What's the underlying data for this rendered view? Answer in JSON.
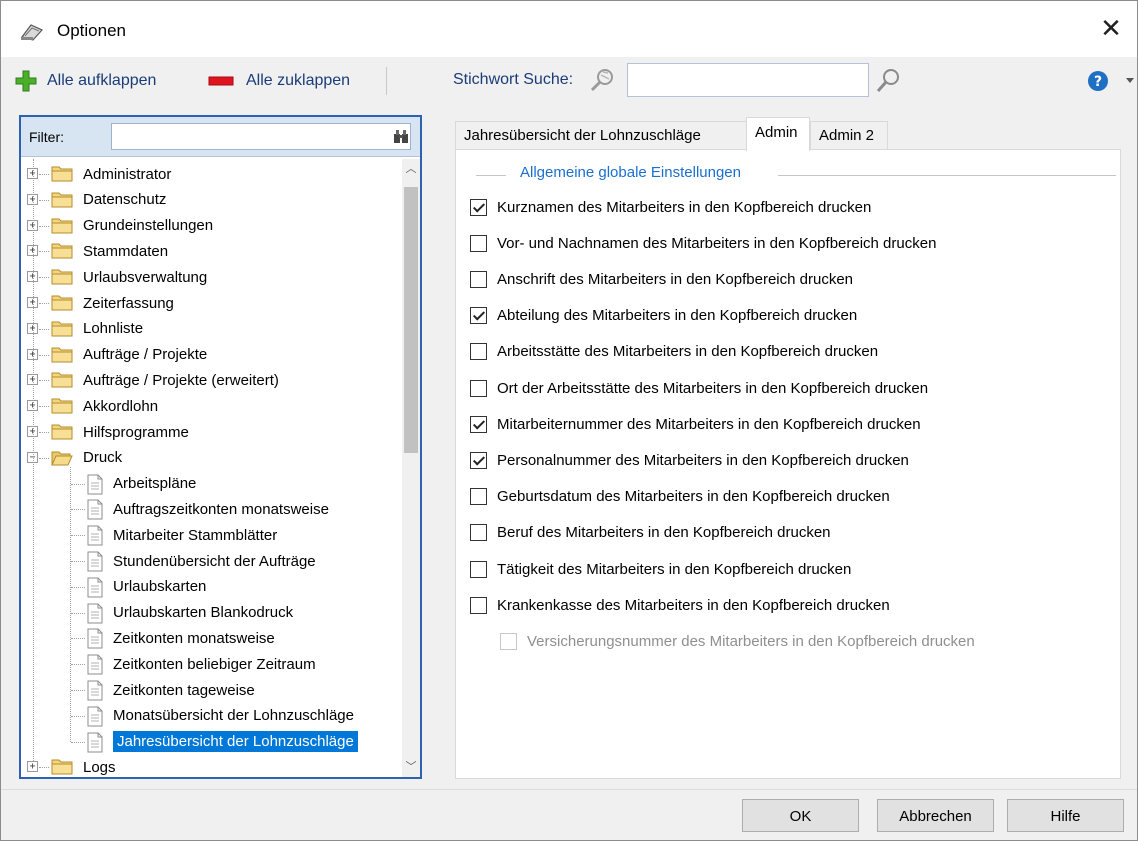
{
  "window": {
    "title": "Optionen",
    "close_glyph": "✕"
  },
  "toolbar": {
    "expand_all": "Alle aufklappen",
    "collapse_all": "Alle zuklappen",
    "search_label": "Stichwort Suche:",
    "search_value": "",
    "help_icon": "help-icon"
  },
  "filter": {
    "label": "Filter:",
    "value": ""
  },
  "tree": {
    "top_level": [
      "Administrator",
      "Datenschutz",
      "Grundeinstellungen",
      "Stammdaten",
      "Urlaubsverwaltung",
      "Zeiterfassung",
      "Lohnliste",
      "Aufträge / Projekte",
      "Aufträge / Projekte (erweitert)",
      "Akkordlohn",
      "Hilfsprogramme"
    ],
    "expanded": "Druck",
    "children": [
      "Arbeitspläne",
      "Auftragszeitkonten monatsweise",
      "Mitarbeiter Stammblätter",
      "Stundenübersicht der Aufträge",
      "Urlaubskarten",
      "Urlaubskarten Blankodruck",
      "Zeitkonten monatsweise",
      "Zeitkonten beliebiger Zeitraum",
      "Zeitkonten tageweise",
      "Monatsübersicht der Lohnzuschläge",
      "Jahresübersicht der Lohnzuschläge"
    ],
    "selected": "Jahresübersicht der Lohnzuschläge",
    "after": "Logs"
  },
  "tabs": [
    {
      "label": "Jahresübersicht der Lohnzuschläge",
      "active": false
    },
    {
      "label": "Admin",
      "active": true
    },
    {
      "label": "Admin 2",
      "active": false
    }
  ],
  "group": {
    "title": "Allgemeine globale Einstellungen"
  },
  "options": [
    {
      "label": "Kurznamen des Mitarbeiters in den Kopfbereich drucken",
      "checked": true
    },
    {
      "label": "Vor- und Nachnamen des Mitarbeiters in den Kopfbereich drucken",
      "checked": false
    },
    {
      "label": "Anschrift des Mitarbeiters in den Kopfbereich drucken",
      "checked": false
    },
    {
      "label": "Abteilung des Mitarbeiters in den Kopfbereich drucken",
      "checked": true
    },
    {
      "label": "Arbeitsstätte des Mitarbeiters in den Kopfbereich drucken",
      "checked": false
    },
    {
      "label": "Ort der Arbeitsstätte des Mitarbeiters in den Kopfbereich drucken",
      "checked": false
    },
    {
      "label": "Mitarbeiternummer des Mitarbeiters in den Kopfbereich drucken",
      "checked": true
    },
    {
      "label": "Personalnummer des Mitarbeiters in den Kopfbereich drucken",
      "checked": true
    },
    {
      "label": "Geburtsdatum des Mitarbeiters in den Kopfbereich drucken",
      "checked": false
    },
    {
      "label": "Beruf des Mitarbeiters in den Kopfbereich drucken",
      "checked": false
    },
    {
      "label": "Tätigkeit des Mitarbeiters in den Kopfbereich drucken",
      "checked": false
    },
    {
      "label": "Krankenkasse des Mitarbeiters in den Kopfbereich drucken",
      "checked": false
    },
    {
      "label": "Versicherungsnummer des Mitarbeiters in den Kopfbereich drucken",
      "checked": false,
      "disabled": true
    }
  ],
  "buttons": {
    "ok": "OK",
    "cancel": "Abbrechen",
    "help": "Hilfe"
  },
  "colors": {
    "accent": "#0078d7",
    "link": "#1a3c78",
    "group_title": "#1a6fd0",
    "panel_border": "#2f61b3"
  }
}
